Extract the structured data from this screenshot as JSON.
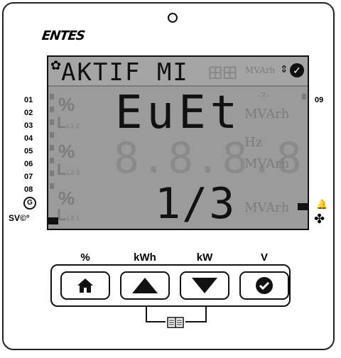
{
  "brand": "ENTES",
  "lcd": {
    "top_text": "AKTIF MI",
    "top_unit": "MVArh",
    "row1_text": "EuEt",
    "row2_text": "8.8.8.8",
    "row3_text": "1/3",
    "row1_unit": "MVArh",
    "row2_unit_hz": "Hz",
    "row2_unit": "MVArh",
    "row3_unit": "MVArh",
    "symbols": "-?- ",
    "phase_labels": [
      "L1-2",
      "L2-3",
      "L3-1"
    ],
    "pct_symbol": "%"
  },
  "left_indicators": [
    "01",
    "02",
    "03",
    "04",
    "05",
    "06",
    "07",
    "08"
  ],
  "right_indicator": "09",
  "generator_label": "G",
  "svc_label": "SV©°",
  "buttons": [
    {
      "label": "%",
      "icon": "home-icon"
    },
    {
      "label": "kWh",
      "icon": "arrow-up-icon"
    },
    {
      "label": "kW",
      "icon": "arrow-down-icon"
    },
    {
      "label": "V",
      "icon": "check-icon"
    }
  ],
  "book_icon": "book-icon"
}
